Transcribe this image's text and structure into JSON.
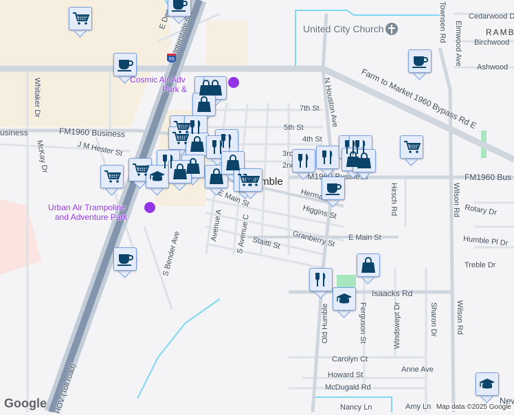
{
  "map": {
    "place_labels": {
      "church": "United City Church",
      "cosmic_1": "Cosmic Air Adv",
      "cosmic_2": "Park &",
      "urban_1": "Urban Air Trampoline",
      "urban_2": "and Adventure Park",
      "humble": "Humble",
      "rambo": "RAMB"
    },
    "streets": {
      "interstate": "Interstate 69",
      "e_den": "E Den",
      "fm1960_bypass": "Farm to Market 1960 Bypass Rd E",
      "fm1960_business_left": "FM1960 Business",
      "business_left": "usiness",
      "fm1960_business_mid": "FM1960 Business",
      "fm1960_business_right": "FM1960 Bus",
      "whitaker": "Whitaker Dr",
      "mckay": "McKay Dr",
      "jm_hester": "J M Hester St",
      "e_main_west": "E Main St",
      "e_main_east": "E Main St",
      "avenue_a": "Avenue A",
      "s_avenue_c": "S Avenue C",
      "staitti": "Staitti St",
      "granberry": "Granberry St",
      "higgins": "Higgins St",
      "herman": "Herman St",
      "s_bender": "S Bender Ave",
      "n_houston": "N Houston Ave",
      "seventh": "7th St",
      "fifth": "5th St",
      "fourth": "4th St",
      "third": "3rd",
      "second": "2nd",
      "townsen": "Townsen Rd",
      "elmwood": "Elmwood Ave",
      "cedarwood": "Cedarwood Dr",
      "birchwood": "Birchwood",
      "ashwood": "Ashwood",
      "hirsch": "Hirsch Rd",
      "wilson": "Wilson Rd",
      "rotary": "Rotary Dr",
      "humble_pl": "Humble Pl Dr",
      "treble": "Treble Dr",
      "isaacks": "Isaacks Rd",
      "old_humble": "Old Humble",
      "ferguson": "Ferguson St",
      "windswept": "Windswept Dr",
      "sharon": "Sharon Dr",
      "carolyn": "Carolyn Ct",
      "anne": "Anne Ave",
      "howard": "Howard St",
      "mcdugald": "McDugald Rd",
      "nancy": "Nancy Ln",
      "amy": "Amy Ln",
      "hov": "HOV (Toll road)",
      "i69_shield": "69",
      "new": "New"
    },
    "markers": [
      "cart",
      "coffee",
      "coffee",
      "bag",
      "bag",
      "bag",
      "cart",
      "restaurant",
      "cart",
      "bag",
      "restaurant",
      "restaurant",
      "cart",
      "restaurant",
      "bag",
      "cart",
      "school",
      "bag",
      "bag",
      "bag",
      "cart",
      "cart",
      "coffee",
      "restaurant",
      "restaurant",
      "restaurant",
      "restaurant",
      "bag",
      "bag",
      "coffee",
      "cart",
      "bag",
      "restaurant",
      "school",
      "school",
      "coffee"
    ],
    "colors": {
      "marker_icon": "#0b4468",
      "marker_bg": "#e4ecfb",
      "poi": "#9334e6",
      "water": "#7fd8f0",
      "highway": "#9aaabb"
    }
  },
  "footer": {
    "logo": "Google",
    "attribution": "Map data ©2025 Google"
  }
}
